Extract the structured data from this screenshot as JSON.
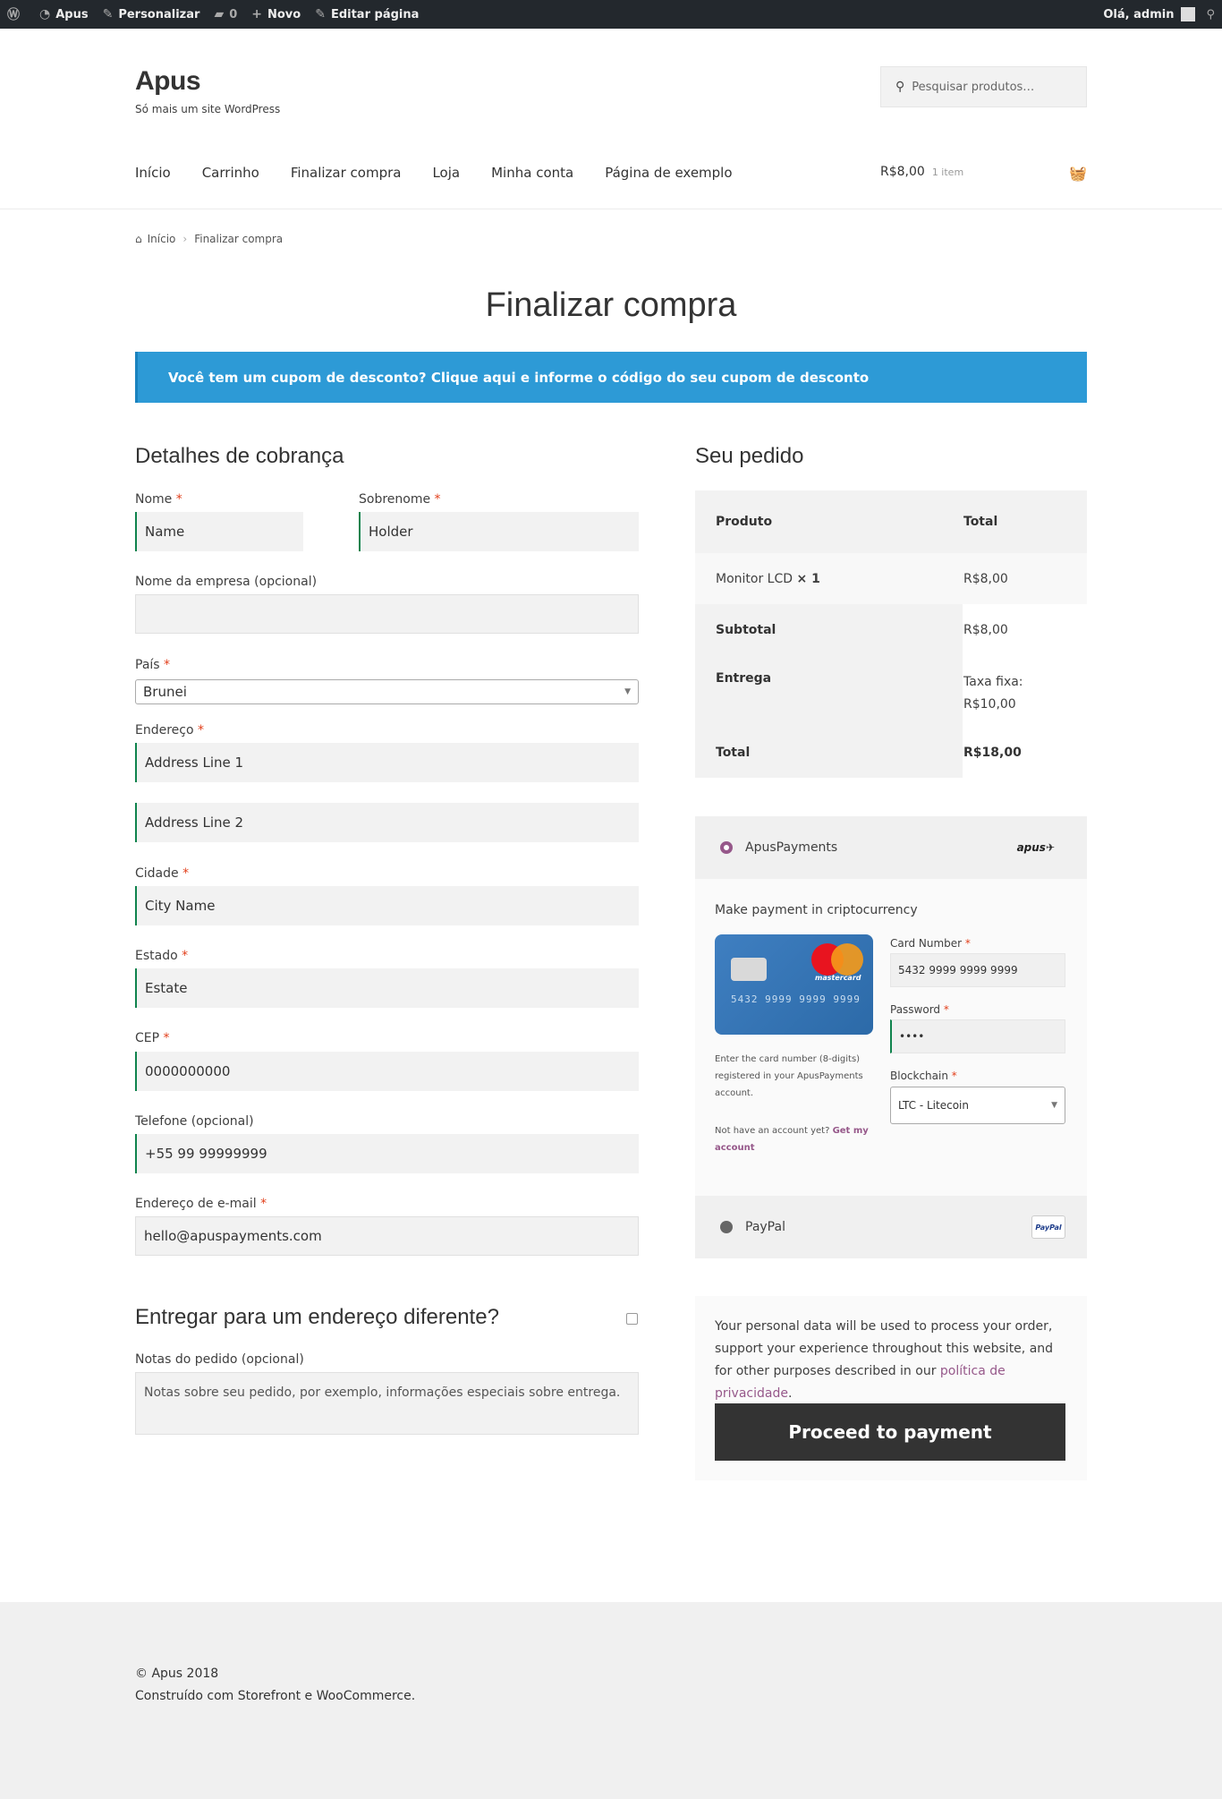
{
  "admin_bar": {
    "site": "Apus",
    "customize": "Personalizar",
    "comments_count": "0",
    "new": "Novo",
    "edit_page": "Editar página",
    "greeting": "Olá, admin"
  },
  "header": {
    "site_title": "Apus",
    "site_description": "Só mais um site WordPress",
    "search_placeholder": "Pesquisar produtos…",
    "nav": [
      "Início",
      "Carrinho",
      "Finalizar compra",
      "Loja",
      "Minha conta",
      "Página de exemplo"
    ],
    "cart_total": "R$8,00",
    "cart_count": "1 item"
  },
  "breadcrumb": {
    "home": "Início",
    "current": "Finalizar compra"
  },
  "page_title": "Finalizar compra",
  "coupon_notice": "Você tem um cupom de desconto? Clique aqui e informe o código do seu cupom de desconto",
  "billing": {
    "heading": "Detalhes de cobrança",
    "first_name_label": "Nome",
    "first_name_value": "Name",
    "last_name_label": "Sobrenome",
    "last_name_value": "Holder",
    "company_label": "Nome da empresa (opcional)",
    "company_value": "",
    "country_label": "País",
    "country_value": "Brunei",
    "address_label": "Endereço",
    "address1_value": "Address Line 1",
    "address2_value": "Address Line 2",
    "city_label": "Cidade",
    "city_value": "City Name",
    "state_label": "Estado",
    "state_value": "Estate",
    "postcode_label": "CEP",
    "postcode_value": "0000000000",
    "phone_label": "Telefone (opcional)",
    "phone_value": "+55 99 99999999",
    "email_label": "Endereço de e-mail",
    "email_value": "hello@apuspayments.com",
    "ship_different_label": "Entregar para um endereço diferente?",
    "notes_label": "Notas do pedido (opcional)",
    "notes_placeholder": "Notas sobre seu pedido, por exemplo, informações especiais sobre entrega.",
    "required_mark": "*"
  },
  "order": {
    "heading": "Seu pedido",
    "col_product": "Produto",
    "col_total": "Total",
    "item_name": "Monitor LCD",
    "item_qty": "× 1",
    "item_total": "R$8,00",
    "subtotal_label": "Subtotal",
    "subtotal_value": "R$8,00",
    "shipping_label": "Entrega",
    "shipping_value_1": "Taxa fixa:",
    "shipping_value_2": "R$10,00",
    "total_label": "Total",
    "total_value": "R$18,00"
  },
  "payment": {
    "apus_label": "ApusPayments",
    "apus_logo_text": "apus",
    "description": "Make payment in criptocurrency",
    "card_brand": "mastercard",
    "card_number_display": "5432 9999 9999 9999",
    "card_help": "Enter the card number (8-digits) registered in your ApusPayments account.",
    "no_account": "Not have an account yet?",
    "get_account": "Get my account",
    "card_number_label": "Card Number",
    "card_number_value": "5432 9999 9999 9999",
    "password_label": "Password",
    "password_value": "••••",
    "blockchain_label": "Blockchain",
    "blockchain_value": "LTC - Litecoin",
    "paypal_label": "PayPal",
    "paypal_logo": "PayPal"
  },
  "privacy": {
    "text": "Your personal data will be used to process your order, support your experience throughout this website, and for other purposes described in our",
    "link": "política de privacidade",
    "end": "."
  },
  "proceed_button": "Proceed to payment",
  "footer": {
    "copyright": "© Apus 2018",
    "built_with": "Construído com Storefront e WooCommerce."
  },
  "colors": {
    "notice_bg": "#2d9ad6",
    "button_bg": "#333333",
    "accent_link": "#96588a",
    "input_border": "#0f834d",
    "required": "#e2401c"
  }
}
